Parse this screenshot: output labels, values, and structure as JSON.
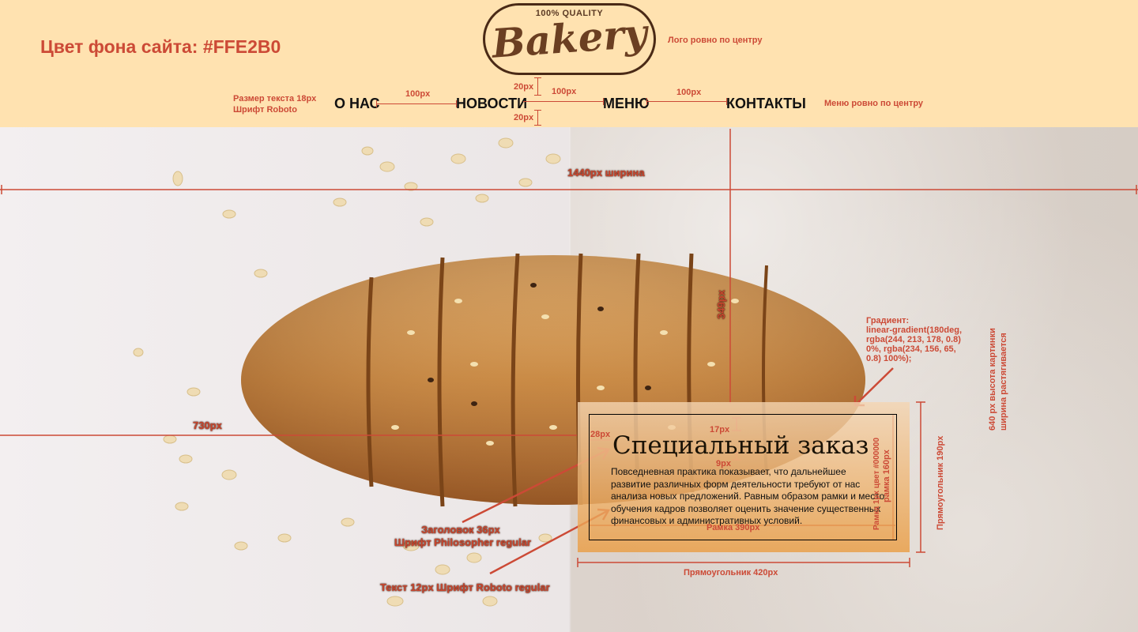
{
  "header": {
    "bg_note": "Цвет фона сайта: #FFE2B0",
    "logo": {
      "top_text": "100% QUALITY",
      "name": "Bakery"
    },
    "logo_note": "Логo ровно по центру",
    "font_note_1": "Размер текста 18px",
    "font_note_2": "Шрифт Roboto",
    "menu_note": "Меню ровно по центру",
    "nav": [
      "О НАС",
      "НОВОСТИ",
      "МЕНЮ",
      "КОНТАКТЫ"
    ],
    "gap_label": "100px",
    "spacing_label": "20px"
  },
  "hero": {
    "width_label": "1440px ширина",
    "height_label": "349px",
    "offset_label": "730px",
    "gradient_note": [
      "Градиент:",
      "linear-gradient(180deg,",
      "rgba(244, 213, 178, 0.8)",
      "0%, rgba(234, 156, 65,",
      "0.8) 100%);"
    ],
    "image_note_1": "640 px высота картинки",
    "image_note_2": "ширина растягивается",
    "card": {
      "title": "Специальный заказ",
      "text": "Повседневная практика показывает, что дальнейшее развитие различных форм деятельности требуют от нас анализа новых предложений. Равным образом рамки и место обучения кадров позволяет оценить значение существенных финансовых и административных условий."
    },
    "card_notes": {
      "top_gap": "17px",
      "left_gap": "28px",
      "title_gap": "9px",
      "frame_note_1": "Рамка 1px цвет #000000",
      "frame_note_2": "рамка 160px",
      "frame_width": "Рамка 390px",
      "rect_height": "Прямоугольник 190px",
      "rect_width": "Прямоугольник 420px"
    },
    "heading_note_1": "Заголовок 36px",
    "heading_note_2": "Шрифт Philosopher regular",
    "text_note": "Текст 12px Шрифт Roboto regular"
  }
}
